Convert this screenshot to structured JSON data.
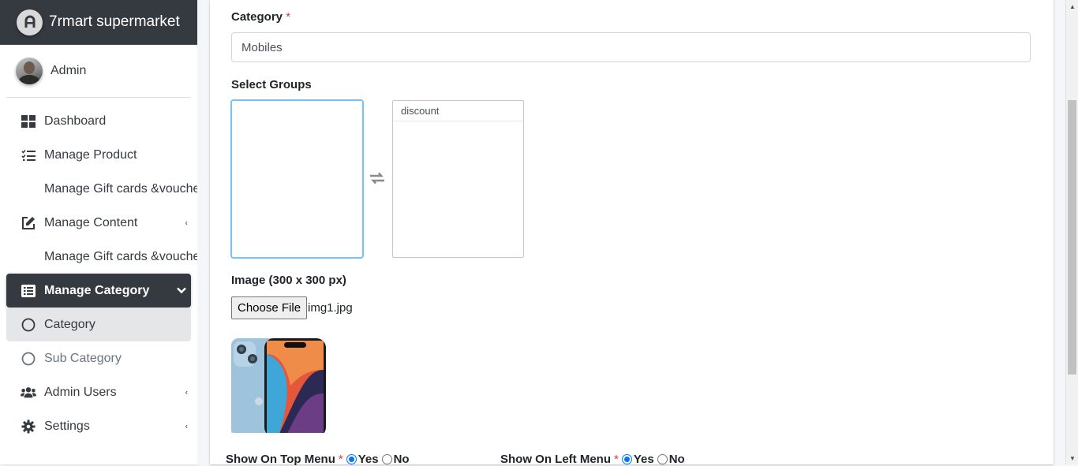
{
  "brand": {
    "name": "7rmart supermarket"
  },
  "user": {
    "name": "Admin"
  },
  "sidebar": {
    "items": [
      {
        "label": "Dashboard"
      },
      {
        "label": "Manage Product"
      },
      {
        "label": "Manage Gift cards &voucher"
      },
      {
        "label": "Manage Content"
      },
      {
        "label": "Manage Gift cards &voucher"
      },
      {
        "label": "Manage Category"
      },
      {
        "label": "Category"
      },
      {
        "label": "Sub Category"
      },
      {
        "label": "Admin Users"
      },
      {
        "label": "Settings"
      }
    ]
  },
  "form": {
    "category": {
      "label": "Category",
      "required_mark": "*",
      "value": "Mobiles"
    },
    "groups": {
      "label": "Select Groups",
      "available": [],
      "selected": [
        "discount"
      ]
    },
    "image": {
      "label": "Image (300 x 300 px)",
      "button_label": "Choose File",
      "file_name": "img1.jpg"
    },
    "top_menu": {
      "label": "Show On Top Menu",
      "required_mark": "*",
      "yes": "Yes",
      "no": "No",
      "value": "Yes"
    },
    "left_menu": {
      "label": "Show On Left Menu",
      "required_mark": "*",
      "yes": "Yes",
      "no": "No",
      "value": "Yes"
    }
  },
  "colors": {
    "sidebar_dark": "#343a40",
    "accent_blue": "#0075ff",
    "required": "#dc3545"
  }
}
